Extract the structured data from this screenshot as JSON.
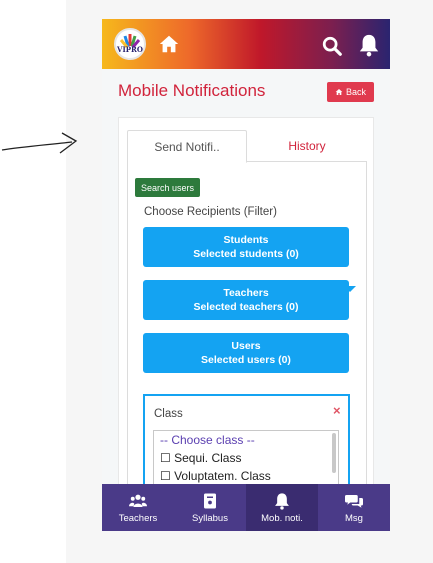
{
  "header": {
    "logo_text": "VIPRO",
    "icons": [
      "home-icon",
      "search-icon",
      "bell-icon"
    ]
  },
  "page": {
    "title": "Mobile Notifications",
    "back_label": "Back"
  },
  "tabs": [
    {
      "label": "Send Notifi..",
      "active": true
    },
    {
      "label": "History",
      "active": false
    }
  ],
  "filters": {
    "search_users_label": "Search users",
    "choose_label": "Choose Recipients (Filter)",
    "students": {
      "title": "Students",
      "sub": "Selected students (0)"
    },
    "teachers": {
      "title": "Teachers",
      "sub": "Selected teachers (0)"
    },
    "users": {
      "title": "Users",
      "sub": "Selected users (0)"
    }
  },
  "class_filter": {
    "label": "Class",
    "options": [
      "-- Choose class --",
      "☐ Sequi. Class",
      "☐ Voluptatem. Class"
    ]
  },
  "bottom_nav": [
    {
      "label": "Teachers",
      "icon": "users-icon",
      "active": false
    },
    {
      "label": "Syllabus",
      "icon": "book-icon",
      "active": false
    },
    {
      "label": "Mob. noti.",
      "icon": "bell-icon",
      "active": true
    },
    {
      "label": "Msg",
      "icon": "chat-icon",
      "active": false
    }
  ],
  "colors": {
    "accent": "#d1243c",
    "primary_blue": "#14a3f2",
    "nav_bg": "#4a3a88",
    "success": "#2d7a3c"
  }
}
